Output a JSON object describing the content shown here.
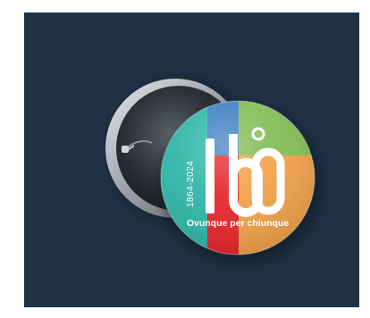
{
  "product": {
    "name": "",
    "years": "1864-2024",
    "slogan": "Ovunque per chiunque",
    "logo_number": "160"
  },
  "colors": {
    "background_panel": "#1f3144",
    "page": "#ffffff",
    "badge_green": "#83bd55",
    "badge_blue": "#3d80c3",
    "badge_orange": "#f2a24a",
    "badge_teal": "#2fb6a8",
    "badge_red": "#e5262b",
    "badge_back_metal": "#bcc2c8"
  },
  "icons": {
    "badge_back": "pin-back-icon",
    "logo_mark": "logo-160-icon"
  }
}
